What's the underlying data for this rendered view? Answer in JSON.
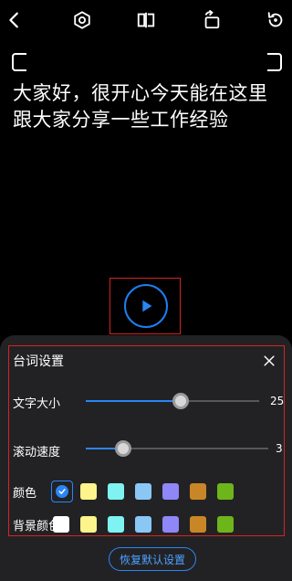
{
  "toolbar": {
    "icons": [
      "back-icon",
      "settings-icon",
      "mirror-icon",
      "rotate-screen-icon",
      "refresh-icon"
    ]
  },
  "prompter": {
    "text": "大家好，很开心今天能在这里\n跟大家分享一些工作经验"
  },
  "panel": {
    "title": "台词设置",
    "font_size_label": "文字大小",
    "font_size_value": "25",
    "font_size_level": 0.52,
    "scroll_speed_label": "滚动速度",
    "scroll_speed_value": "3",
    "scroll_speed_level": 0.18,
    "color_label": "颜色",
    "bg_color_label": "背景颜色",
    "text_colors": [
      "#000000",
      "#fdf48b",
      "#7ef3f2",
      "#8ac7f5",
      "#8f86f7",
      "#c98627",
      "#6db51b"
    ],
    "bg_colors": [
      "#ffffff",
      "#fdf48b",
      "#7ef3f2",
      "#8ac7f5",
      "#8f86f7",
      "#c98627",
      "#6db51b"
    ],
    "reset_label": "恢复默认设置"
  },
  "colors": {
    "accent": "#2a85f5",
    "highlight": "#d6241f",
    "panel_bg": "#222225"
  }
}
